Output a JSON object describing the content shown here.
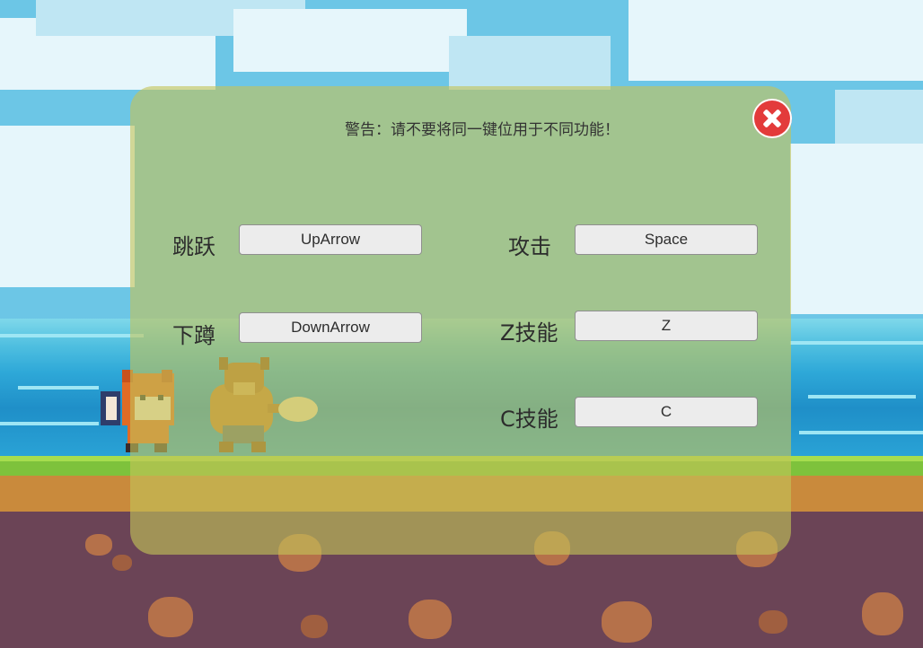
{
  "dialog": {
    "warning_text": "警告：请不要将同一键位用于不同功能！"
  },
  "bindings": {
    "jump": {
      "label": "跳跃",
      "key": "UpArrow"
    },
    "crouch": {
      "label": "下蹲",
      "key": "DownArrow"
    },
    "attack": {
      "label": "攻击",
      "key": "Space"
    },
    "z_skill": {
      "label": "Z技能",
      "key": "Z"
    },
    "c_skill": {
      "label": "C技能",
      "key": "C"
    }
  },
  "icons": {
    "close": "close-icon"
  },
  "colors": {
    "panel": "#c4c458",
    "close": "#e33b3b",
    "button": "#ececec"
  }
}
